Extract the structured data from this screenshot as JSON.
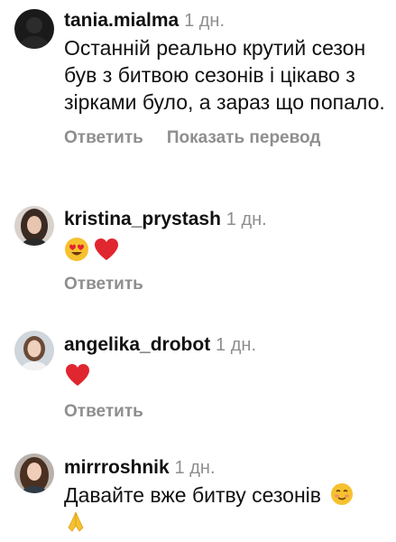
{
  "comments": [
    {
      "username": "tania.mialma",
      "time": "1 дн.",
      "text": "Останній реально крутий сезон був з битвою сезонів і цікаво з зірками було, а зараз що попало.",
      "actions": [
        "Ответить",
        "Показать перевод"
      ],
      "avatar_icon": "dark-profile-photo"
    },
    {
      "username": "kristina_prystash",
      "time": "1 дн.",
      "emojis": [
        "heart-eyes-emoji",
        "red-heart-emoji"
      ],
      "actions": [
        "Ответить"
      ],
      "avatar_icon": "woman-dark-hair-photo"
    },
    {
      "username": "angelika_drobot",
      "time": "1 дн.",
      "emojis": [
        "red-heart-emoji"
      ],
      "actions": [
        "Ответить"
      ],
      "avatar_icon": "woman-light-photo"
    },
    {
      "username": "mirrroshnik",
      "time": "1 дн.",
      "text": "Давайте вже битву сезонів",
      "emojis": [
        "smiling-face-emoji",
        "folded-hands-emoji"
      ],
      "avatar_icon": "woman-long-hair-photo"
    }
  ],
  "colors": {
    "text": "#111111",
    "muted": "#8e8e8e",
    "heart": "#e0262f",
    "emoji_face": "#f6c12e"
  }
}
